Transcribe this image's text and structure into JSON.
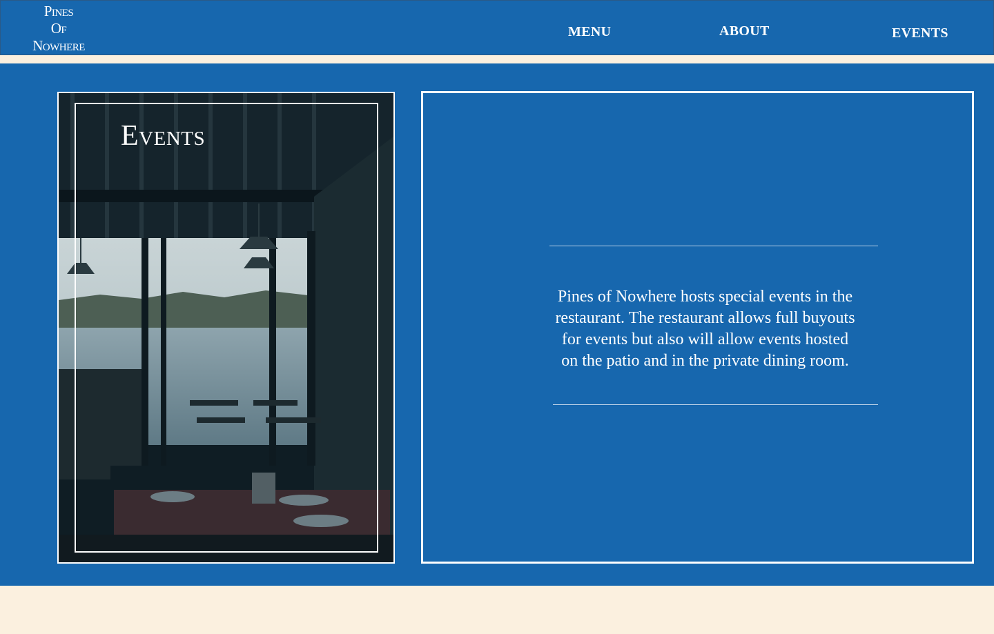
{
  "header": {
    "logo_lines": [
      "Pines",
      "Of",
      "Nowhere"
    ],
    "nav": {
      "menu": "MENU",
      "about": "ABOUT",
      "events": "EVENTS"
    }
  },
  "hero": {
    "title": "Events",
    "description": "Pines of Nowhere hosts special events in the restaurant. The restaurant allows full buyouts for events but also will allow events hosted on the patio and in the private dining room."
  },
  "colors": {
    "primary_blue": "#1767ae",
    "cream": "#fbf0df",
    "white": "#ffffff"
  }
}
